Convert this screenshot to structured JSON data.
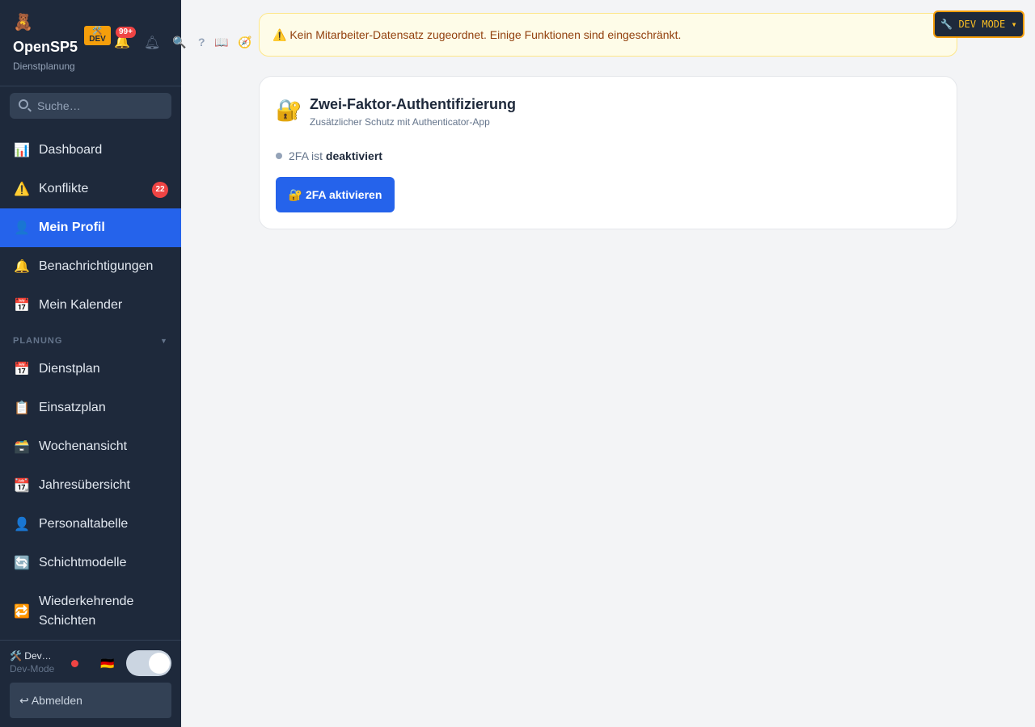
{
  "brand": {
    "logo": "🧸",
    "title": "OpenSP5",
    "subtitle": "Dienstplanung",
    "dev_badge_icon": "🛠️",
    "dev_badge_label": "DEV",
    "notification_count": "99+"
  },
  "header_icons": {
    "search": "🔍",
    "help": "?",
    "docs": "📖",
    "tour": "🧭"
  },
  "search": {
    "placeholder": "Suche…"
  },
  "nav": {
    "items": [
      {
        "icon": "📊",
        "label": "Dashboard"
      },
      {
        "icon": "⚠️",
        "label": "Konflikte",
        "badge": "22"
      },
      {
        "icon": "👤",
        "label": "Mein Profil"
      },
      {
        "icon": "🔔",
        "label": "Benachrichtigungen"
      },
      {
        "icon": "📅",
        "label": "Mein Kalender"
      }
    ],
    "section_label": "PLANUNG",
    "section_items": [
      {
        "icon": "📅",
        "label": "Dienstplan"
      },
      {
        "icon": "📋",
        "label": "Einsatzplan"
      },
      {
        "icon": "🗃️",
        "label": "Wochenansicht"
      },
      {
        "icon": "📆",
        "label": "Jahresübersicht"
      },
      {
        "icon": "👤",
        "label": "Personaltabelle"
      },
      {
        "icon": "🔄",
        "label": "Schichtmodelle"
      },
      {
        "icon": "🔁",
        "label": "Wiederkehrende Schichten"
      }
    ],
    "active": "Mein Profil"
  },
  "user": {
    "name": "🛠️ Dev…",
    "role": "Dev-Mode",
    "flag": "🇩🇪",
    "logout_label": "↩ Abmelden"
  },
  "alert": {
    "text": "⚠️ Kein Mitarbeiter-Datensatz zugeordnet. Einige Funktionen sind eingeschränkt."
  },
  "twofa": {
    "icon": "🔐",
    "title": "Zwei-Faktor-Authentifizierung",
    "subtitle": "Zusätzlicher Schutz mit Authenticator-App",
    "status_prefix": "2FA ist",
    "status_value": "deaktiviert",
    "button_label": "🔐 2FA aktivieren"
  },
  "devmode": {
    "label": "🔧 DEV MODE ▾"
  },
  "colors": {
    "sidebar_bg": "#1e293b",
    "accent": "#2563eb",
    "badge_red": "#ef4444",
    "dev_amber": "#f59e0b"
  }
}
